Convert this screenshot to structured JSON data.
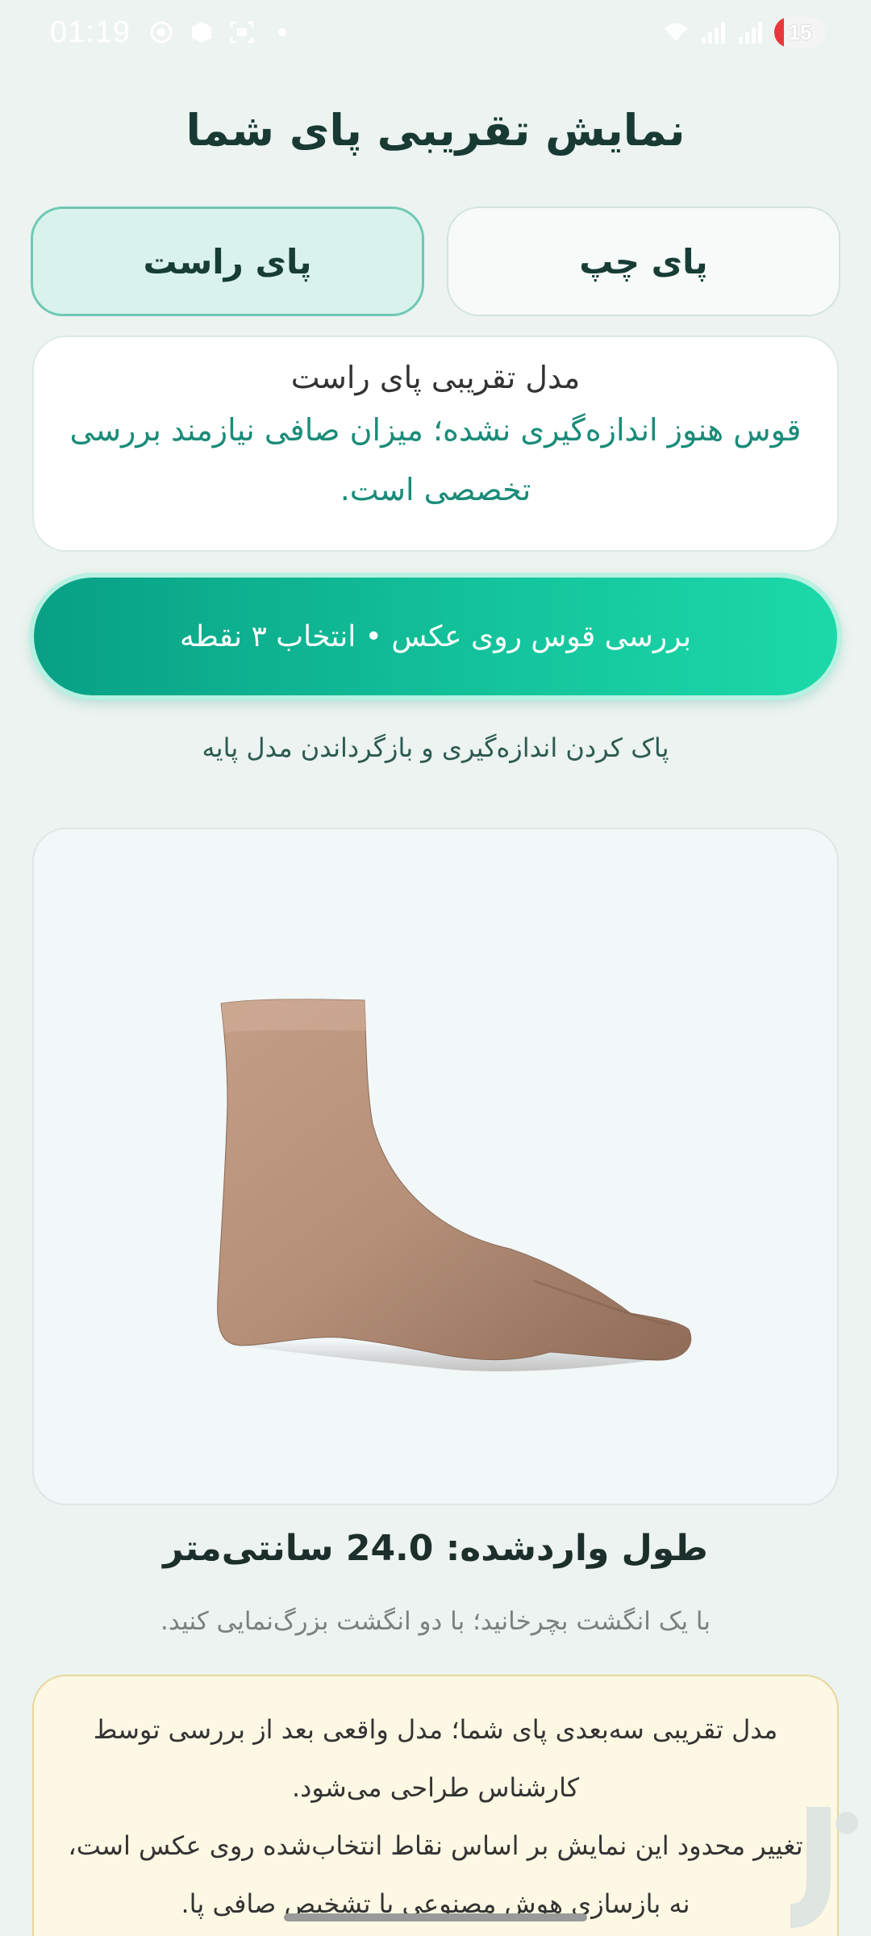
{
  "status_bar": {
    "time": "01:19",
    "battery": "15",
    "icons": [
      "chrome-icon",
      "shield-icon",
      "scan-icon",
      "dot-icon",
      "wifi-icon",
      "signal-icon",
      "signal-icon",
      "battery-icon"
    ]
  },
  "page": {
    "title": "نمایش تقریبی پای شما"
  },
  "foot_selector": {
    "left_label": "پای چپ",
    "right_label": "پای راست",
    "selected": "right"
  },
  "info_card": {
    "title": "مدل تقریبی پای راست",
    "message": "قوس هنوز اندازه‌گیری نشده؛ میزان صافی نیازمند بررسی تخصصی است."
  },
  "actions": {
    "check_arch": "بررسی قوس روی عکس • انتخاب ۳ نقطه",
    "reset": "پاک کردن اندازه‌گیری و بازگرداندن مدل پایه"
  },
  "viewer": {
    "model": "foot-3d-model"
  },
  "length": {
    "label": "طول واردشده: 24.0 سانتی‌متر"
  },
  "hint": "با یک انگشت بچرخانید؛ با دو انگشت بزرگ‌نمایی کنید.",
  "note": {
    "line1": "مدل تقریبی سه‌بعدی پای شما؛ مدل واقعی بعد از بررسی توسط کارشناس طراحی می‌شود.",
    "line2": "تغییر محدود این نمایش بر اساس نقاط انتخاب‌شده روی عکس است، نه بازسازی هوش مصنوعی یا تشخیص صافی پا."
  },
  "colors": {
    "accent": "#14c59d",
    "accent_dark": "#08a085",
    "selected_bg": "#d9f2ec",
    "note_bg": "#fdf8e4",
    "background": "#ecf3f0"
  }
}
